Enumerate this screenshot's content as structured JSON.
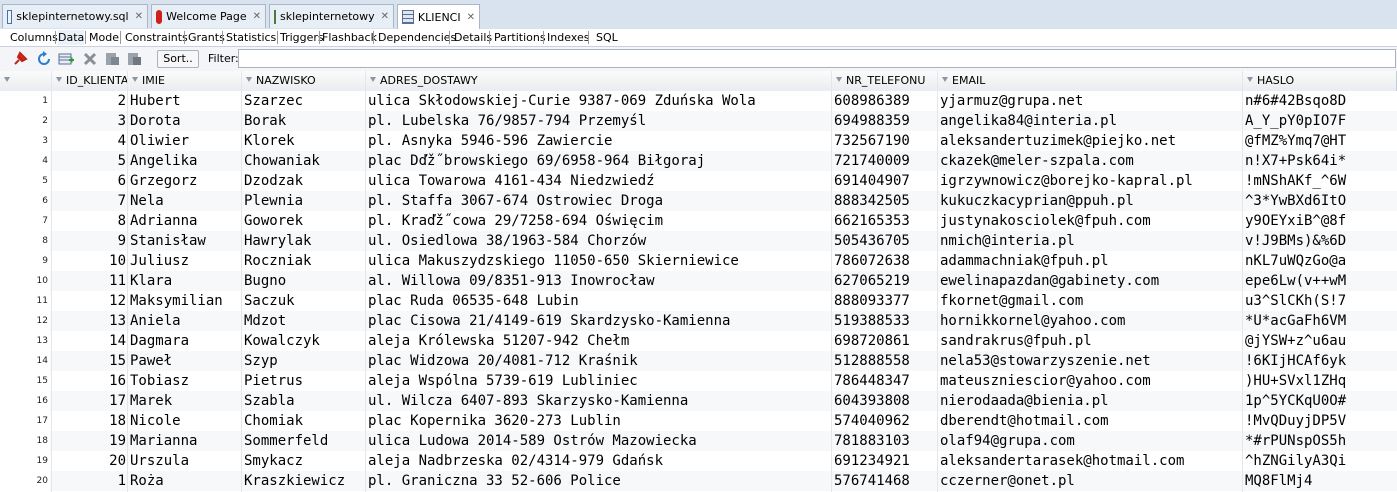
{
  "tabs": [
    {
      "label": "sklepinternetowy.sql",
      "icon": "sql-file-icon",
      "active": false
    },
    {
      "label": "Welcome Page",
      "icon": "oracle-icon",
      "active": false
    },
    {
      "label": "sklepinternetowy",
      "icon": "connection-icon",
      "active": false
    },
    {
      "label": "KLIENCI",
      "icon": "table-icon",
      "active": true
    }
  ],
  "subtabs": [
    "Columns",
    "Data",
    "Model",
    "Constraints",
    "Grants",
    "Statistics",
    "Triggers",
    "Flashback",
    "Dependencies",
    "Details",
    "Partitions",
    "Indexes",
    "SQL"
  ],
  "toolbar": {
    "icons": [
      "pin-icon",
      "refresh-icon",
      "insert-row-icon",
      "delete-row-icon",
      "commit-icon",
      "rollback-icon"
    ],
    "sort_label": "Sort..",
    "filter_label": "Filter:",
    "filter_value": ""
  },
  "grid": {
    "columns": [
      "ID_KLIENTA",
      "IMIE",
      "NAZWISKO",
      "ADRES_DOSTAWY",
      "NR_TELEFONU",
      "EMAIL",
      "HASLO"
    ],
    "rows": [
      {
        "n": "1",
        "id": "2",
        "imie": "Hubert",
        "nazwisko": "Szarzec",
        "adres": "ulica Skłodowskiej-Curie 9387-069 Zduńska Wola",
        "tel": "608986389",
        "email": "yjarmuz@grupa.net",
        "haslo": "n#6#42Bsqo8D"
      },
      {
        "n": "2",
        "id": "3",
        "imie": "Dorota",
        "nazwisko": "Borak",
        "adres": "pl. Lubelska 76/9857-794 Przemyśl",
        "tel": "694988359",
        "email": "angelika84@interia.pl",
        "haslo": "A_Y_pY0pIO7F"
      },
      {
        "n": "3",
        "id": "4",
        "imie": "Oliwier",
        "nazwisko": "Klorek",
        "adres": "pl. Asnyka 5946-596 Zawiercie",
        "tel": "732567190",
        "email": "aleksandertuzimek@piejko.net",
        "haslo": "@fMZ%Ymq7@HT"
      },
      {
        "n": "4",
        "id": "5",
        "imie": "Angelika",
        "nazwisko": "Chowaniak",
        "adres": "plac Dďž˝browskiego 69/6958-964 Biłgoraj",
        "tel": "721740009",
        "email": "ckazek@meler-szpala.com",
        "haslo": "n!X7+Psk64i*"
      },
      {
        "n": "5",
        "id": "6",
        "imie": "Grzegorz",
        "nazwisko": "Dzodzak",
        "adres": "ulica Towarowa 4161-434 Niedzwiedź",
        "tel": "691404907",
        "email": "igrzywnowicz@borejko-kapral.pl",
        "haslo": "!mNShAKf_^6W"
      },
      {
        "n": "6",
        "id": "7",
        "imie": "Nela",
        "nazwisko": "Plewnia",
        "adres": "pl. Staffa 3067-674 Ostrowiec Droga",
        "tel": "888342505",
        "email": "kukuczkacyprian@ppuh.pl",
        "haslo": "^3*YwBXd6ItO"
      },
      {
        "n": "7",
        "id": "8",
        "imie": "Adrianna",
        "nazwisko": "Goworek",
        "adres": "pl. Kraďž˝cowa 29/7258-694 Oświęcim",
        "tel": "662165353",
        "email": "justynakosciolek@fpuh.com",
        "haslo": "y9OEYxiB^@8f"
      },
      {
        "n": "8",
        "id": "9",
        "imie": "Stanisław",
        "nazwisko": "Hawrylak",
        "adres": "ul. Osiedlowa 38/1963-584 Chorzów",
        "tel": "505436705",
        "email": "nmich@interia.pl",
        "haslo": "v!J9BMs)&%6D"
      },
      {
        "n": "9",
        "id": "10",
        "imie": "Juliusz",
        "nazwisko": "Roczniak",
        "adres": "ulica Makuszydzskiego 11050-650 Skierniewice",
        "tel": "786072638",
        "email": "adammachniak@fpuh.pl",
        "haslo": "nKL7uWQzGo@a"
      },
      {
        "n": "10",
        "id": "11",
        "imie": "Klara",
        "nazwisko": "Bugno",
        "adres": "al. Willowa 09/8351-913 Inowrocław",
        "tel": "627065219",
        "email": "ewelinapazdan@gabinety.com",
        "haslo": "epe6Lw(v++wM"
      },
      {
        "n": "11",
        "id": "12",
        "imie": "Maksymilian",
        "nazwisko": "Saczuk",
        "adres": "plac Ruda 06535-648 Lubin",
        "tel": "888093377",
        "email": "fkornet@gmail.com",
        "haslo": "u3^SlCKh(S!7"
      },
      {
        "n": "12",
        "id": "13",
        "imie": "Aniela",
        "nazwisko": "Mdzot",
        "adres": "plac Cisowa 21/4149-619 Skardzysko-Kamienna",
        "tel": "519388533",
        "email": "hornikkornel@yahoo.com",
        "haslo": "*U*acGaFh6VM"
      },
      {
        "n": "13",
        "id": "14",
        "imie": "Dagmara",
        "nazwisko": "Kowalczyk",
        "adres": "aleja Królewska 51207-942 Chełm",
        "tel": "698720861",
        "email": "sandrakrus@fpuh.pl",
        "haslo": "@jYSW+z^u6au"
      },
      {
        "n": "14",
        "id": "15",
        "imie": "Paweł",
        "nazwisko": "Szyp",
        "adres": "plac Widzowa 20/4081-712 Kraśnik",
        "tel": "512888558",
        "email": "nela53@stowarzyszenie.net",
        "haslo": "!6KIjHCAf6yk"
      },
      {
        "n": "15",
        "id": "16",
        "imie": "Tobiasz",
        "nazwisko": "Pietrus",
        "adres": "aleja Wspólna 5739-619 Lubliniec",
        "tel": "786448347",
        "email": "mateuszniescior@yahoo.com",
        "haslo": ")HU+SVxl1ZHq"
      },
      {
        "n": "16",
        "id": "17",
        "imie": "Marek",
        "nazwisko": "Szabla",
        "adres": "ul. Wilcza 6407-893 Skarzysko-Kamienna",
        "tel": "604393808",
        "email": "nierodaada@bienia.pl",
        "haslo": "1p^5YCKqU0O#"
      },
      {
        "n": "17",
        "id": "18",
        "imie": "Nicole",
        "nazwisko": "Chomiak",
        "adres": "plac Kopernika 3620-273 Lublin",
        "tel": "574040962",
        "email": "dberendt@hotmail.com",
        "haslo": "!MvQDuyjDP5V"
      },
      {
        "n": "18",
        "id": "19",
        "imie": "Marianna",
        "nazwisko": "Sommerfeld",
        "adres": "ulica Ludowa 2014-589 Ostrów Mazowiecka",
        "tel": "781883103",
        "email": "olaf94@grupa.com",
        "haslo": "*#rPUNspOS5h"
      },
      {
        "n": "19",
        "id": "20",
        "imie": "Urszula",
        "nazwisko": "Smykacz",
        "adres": "aleja Nadbrzeska 02/4314-979 Gdańsk",
        "tel": "691234921",
        "email": "aleksandertarasek@hotmail.com",
        "haslo": "^hZNGilyA3Qi"
      },
      {
        "n": "20",
        "id": "1",
        "imie": "Roża",
        "nazwisko": "Kraszkiewicz",
        "adres": "pl. Graniczna 33 52-606 Police",
        "tel": "576741468",
        "email": "cczerner@onet.pl",
        "haslo": "MQ8FlMj4"
      }
    ]
  }
}
